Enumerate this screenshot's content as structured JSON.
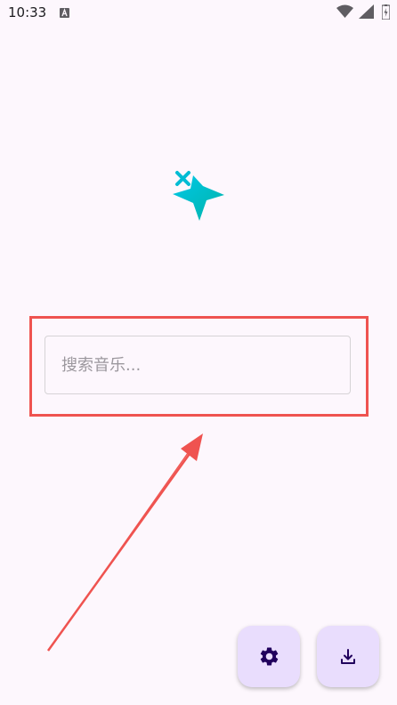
{
  "status_bar": {
    "time": "10:33"
  },
  "search": {
    "placeholder": "搜索音乐..."
  },
  "icons": {
    "app_logo": "sparkle-star-icon",
    "settings": "gear-icon",
    "download": "download-icon"
  },
  "colors": {
    "background": "#fdf7fd",
    "fab_background": "#e9ddfd",
    "fab_icon": "#21005d",
    "annotation": "#ef5350",
    "logo_gradient_start": "#00c4e0",
    "logo_gradient_end": "#00b3b0"
  }
}
